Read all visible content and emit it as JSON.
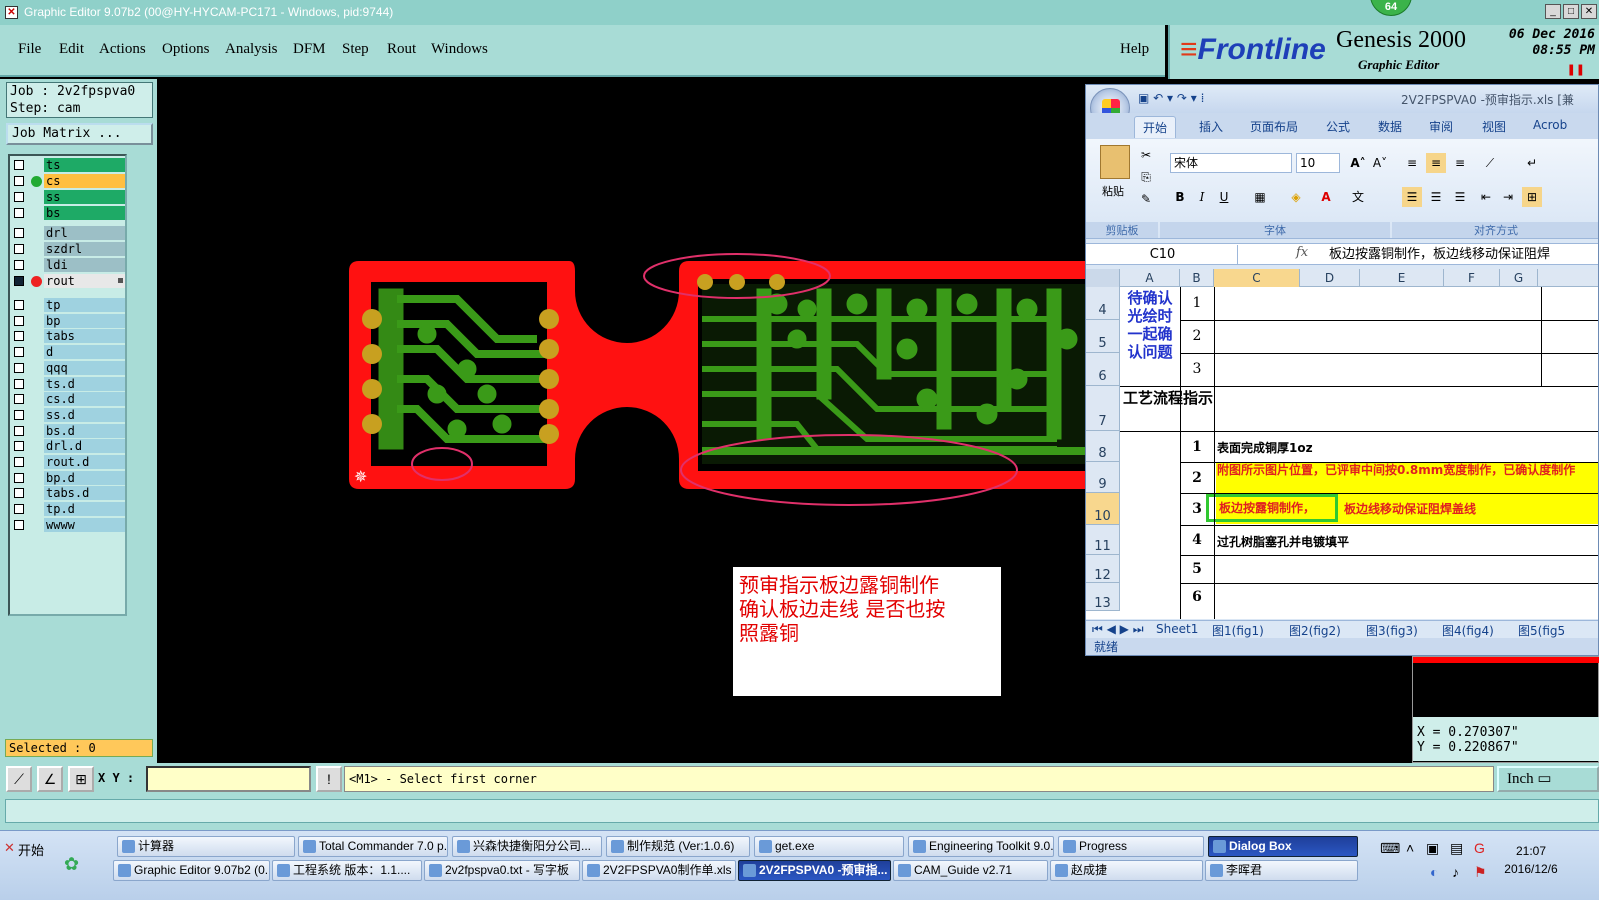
{
  "window": {
    "title": "Graphic Editor 9.07b2 (00@HY-HYCAM-PC171 - Windows, pid:9744)",
    "badge": "64"
  },
  "menu": {
    "items": [
      "File",
      "Edit",
      "Actions",
      "Options",
      "Analysis",
      "DFM",
      "Step",
      "Rout",
      "Windows"
    ],
    "help": "Help"
  },
  "brand": {
    "logo": "Frontline",
    "product": "Genesis 2000",
    "subtitle": "Graphic Editor",
    "date": "06 Dec 2016",
    "time": "08:55 PM"
  },
  "job": {
    "job_line": "Job : 2v2fpspva0",
    "step_line": "Step: cam",
    "matrix_button": "Job Matrix ..."
  },
  "layers": {
    "group1": [
      {
        "name": "ts",
        "color": "#1eaa66"
      },
      {
        "name": "cs",
        "color": "#ffbf40"
      },
      {
        "name": "ss",
        "color": "#1eaa66"
      },
      {
        "name": "bs",
        "color": "#1eaa66"
      }
    ],
    "group2": [
      {
        "name": "drl",
        "color": "#9cbfc6"
      },
      {
        "name": "szdrl",
        "color": "#9cbfc6"
      },
      {
        "name": "ldi",
        "color": "#9cbfc6"
      },
      {
        "name": "rout",
        "color": "#e8e8e8"
      }
    ],
    "group3": [
      "tp",
      "bp",
      "tabs",
      "d",
      "qqq",
      "ts.d",
      "cs.d",
      "ss.d",
      "bs.d",
      "drl.d",
      "rout.d",
      "bp.d",
      "tabs.d",
      "tp.d",
      "wwww"
    ]
  },
  "selected": "Selected : 0",
  "canvas_note": {
    "line1": "预审指示板边露铜制作",
    "line2": "确认板边走线 是否也按",
    "line3": "照露铜"
  },
  "coords": {
    "x": "X = 0.270307\"",
    "y": "Y = 0.220867\""
  },
  "status": {
    "xy_label": "X Y :",
    "prompt": "<M1> - Select first corner",
    "units": "Inch"
  },
  "excel": {
    "title": "2V2FPSPVA0 -预审指示.xls [兼",
    "tabs": [
      "开始",
      "插入",
      "页面布局",
      "公式",
      "数据",
      "审阅",
      "视图",
      "Acrob"
    ],
    "font_name": "宋体",
    "font_size": "10",
    "group_labels": [
      "剪贴板",
      "字体",
      "对齐方式"
    ],
    "paste_label": "粘贴",
    "name_box": "C10",
    "formula": "板边按露铜制作，板边线移动保证阻焊",
    "columns": [
      "A",
      "B",
      "C",
      "D",
      "E",
      "F",
      "G"
    ],
    "row_numbers": [
      "4",
      "5",
      "6",
      "7",
      "8",
      "9",
      "10",
      "11",
      "12",
      "13"
    ],
    "confirm_label": "待确认光绘时一起确认问题",
    "process_label": "工艺流程指示",
    "pending_nums": [
      "1",
      "2",
      "3"
    ],
    "process_nums": [
      "1",
      "2",
      "3",
      "4",
      "5",
      "6"
    ],
    "row8": "表面完成铜厚1oz",
    "row9": "附图所示图片位置，已评审中间按0.8mm宽度制作，已确认度制作",
    "row10a": "板边按露铜制作，",
    "row10b": "板边线移动保证阻焊盖线",
    "row11": "过孔树脂塞孔并电镀填平",
    "sheets": [
      "Sheet1",
      "图1(fig1)",
      "图2(fig2)",
      "图3(fig3)",
      "图4(fig4)",
      "图5(fig5"
    ],
    "status": "就绪"
  },
  "taskbar": {
    "start": "开始",
    "row1": [
      "计算器",
      "Total Commander 7.0 p...",
      "兴森快捷衡阳分公司...",
      "制作规范 (Ver:1.0.6)",
      "get.exe",
      "Engineering Toolkit 9.0...",
      "Progress",
      "Dialog Box"
    ],
    "row2": [
      "Graphic Editor 9.07b2 (0...",
      "工程系统  版本：1.1....",
      "2v2fpspva0.txt - 写字板",
      "2V2FPSPVA0制作单.xls ...",
      "2V2FPSPVA0 -预审指...",
      "CAM_Guide v2.71",
      "赵成捷",
      "李晖君"
    ],
    "time": "21:07",
    "date": "2016/12/6"
  }
}
